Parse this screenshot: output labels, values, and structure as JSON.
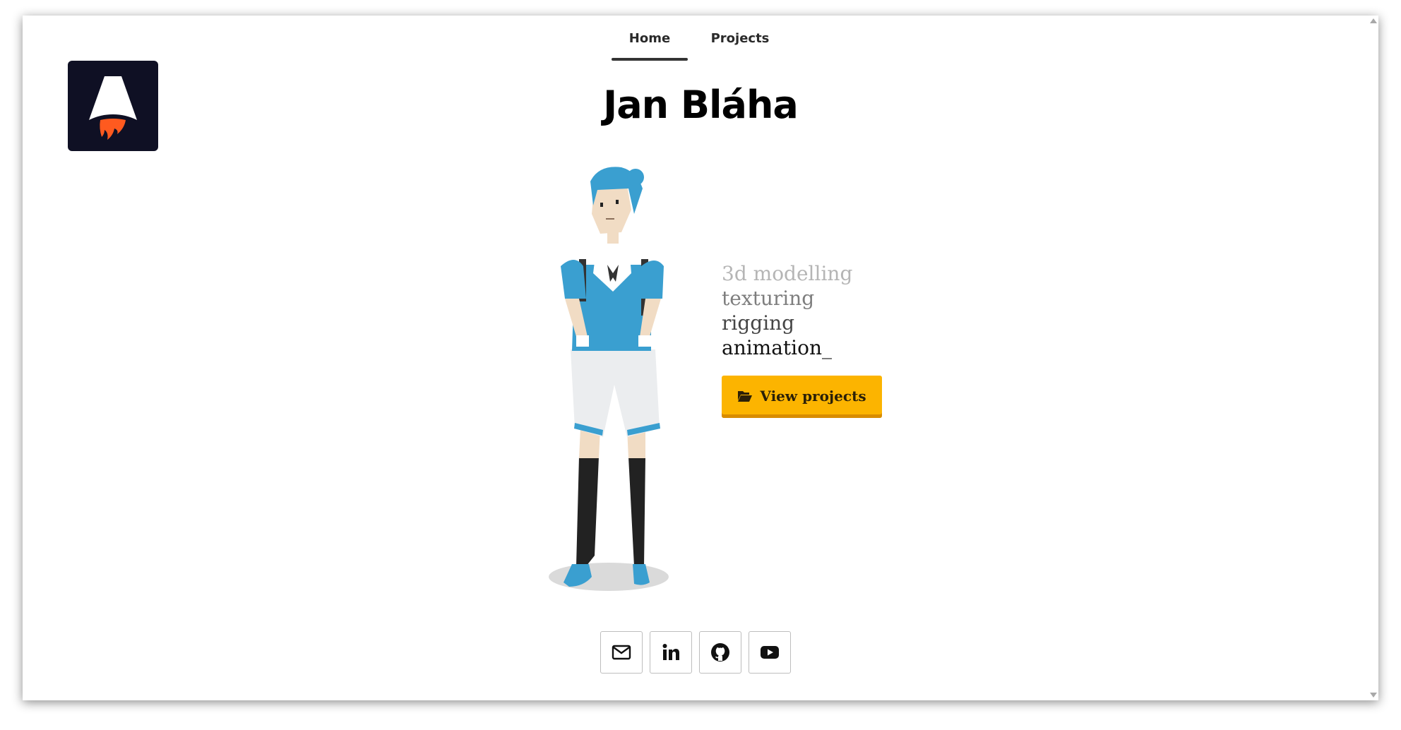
{
  "nav": {
    "items": [
      {
        "label": "Home",
        "active": true
      },
      {
        "label": "Projects",
        "active": false
      }
    ]
  },
  "logo": {
    "icon": "astro-rocket-logo",
    "bg_color": "#0f1024",
    "flame_color": "#ff5a1f"
  },
  "hero": {
    "name": "Jan Bláha",
    "skills": [
      "3d modelling",
      "texturing",
      "rigging",
      "animation_"
    ],
    "cta": {
      "label": "View projects",
      "icon": "folder-open-icon",
      "color": "#fcb400"
    },
    "character_icon": "3d-character-model"
  },
  "socials": [
    {
      "icon": "envelope-icon",
      "service": "email"
    },
    {
      "icon": "linkedin-icon",
      "service": "linkedin"
    },
    {
      "icon": "github-icon",
      "service": "github"
    },
    {
      "icon": "youtube-icon",
      "service": "youtube"
    }
  ]
}
